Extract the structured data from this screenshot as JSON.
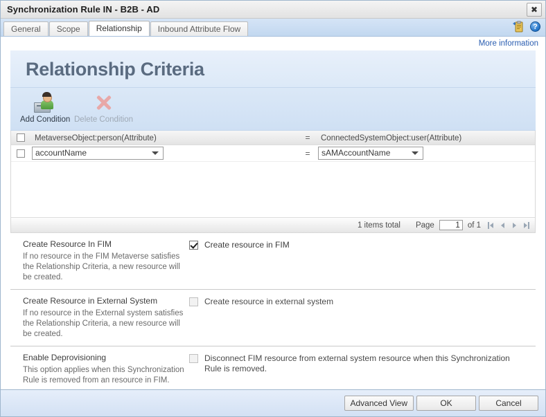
{
  "window": {
    "title": "Synchronization Rule IN - B2B - AD",
    "close_label": "✖"
  },
  "tabs": [
    {
      "label": "General",
      "active": false
    },
    {
      "label": "Scope",
      "active": false
    },
    {
      "label": "Relationship",
      "active": true
    },
    {
      "label": "Inbound Attribute Flow",
      "active": false
    }
  ],
  "tabstrip_icons": {
    "clipboard": "clipboard-add-icon",
    "help": "?"
  },
  "more_information": {
    "label": "More information"
  },
  "section": {
    "title": "Relationship Criteria"
  },
  "toolbar": {
    "add_condition": "Add Condition",
    "delete_condition": "Delete Condition"
  },
  "grid": {
    "header": {
      "left": "MetaverseObject:person(Attribute)",
      "operator": "=",
      "right": "ConnectedSystemObject:user(Attribute)"
    },
    "rows": [
      {
        "left_value": "accountName",
        "operator": "=",
        "right_value": "sAMAccountName"
      }
    ],
    "footer": {
      "items_total": "1 items total",
      "page_label": "Page",
      "page_value": "1",
      "of_label": "of 1"
    }
  },
  "options": [
    {
      "title": "Create Resource In FIM",
      "desc": "If no resource in the FIM Metaverse satisfies the Relationship Criteria, a new resource will be created.",
      "checkbox_label": "Create resource in FIM",
      "checked": true,
      "disabled": false
    },
    {
      "title": "Create Resource in External System",
      "desc": "If no resource in the External system satisfies the Relationship Criteria, a new resource will be created.",
      "checkbox_label": "Create resource in external system",
      "checked": false,
      "disabled": true
    },
    {
      "title": "Enable Deprovisioning",
      "desc": "This option applies when this Synchronization Rule is removed from an resource in FIM.",
      "checkbox_label": "Disconnect FIM resource from external system resource when this Synchronization Rule is removed.",
      "checked": false,
      "disabled": true
    }
  ],
  "footer_buttons": {
    "advanced_view": "Advanced View",
    "ok": "OK",
    "cancel": "Cancel"
  },
  "colors": {
    "accent_blue": "#2a5db0",
    "tab_strip": "#c9dcf2",
    "heading": "#5a6b80",
    "panel_blue": "#dbe8f7"
  }
}
